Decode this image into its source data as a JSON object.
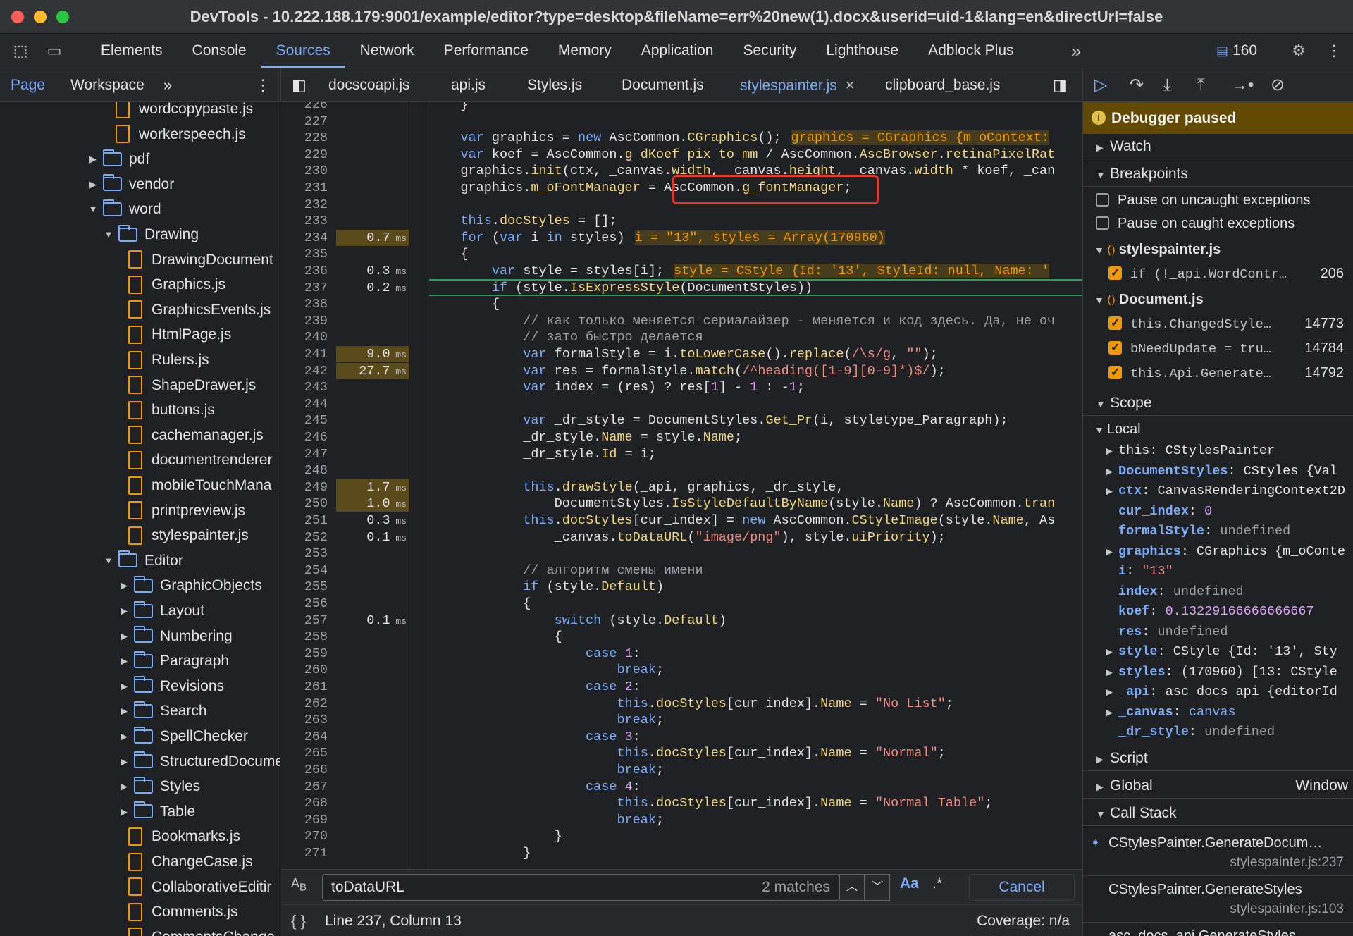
{
  "window": {
    "title": "DevTools - 10.222.188.179:9001/example/editor?type=desktop&fileName=err%20new(1).docx&userid=uid-1&lang=en&directUrl=false"
  },
  "panel_tabs": [
    "Elements",
    "Console",
    "Sources",
    "Network",
    "Performance",
    "Memory",
    "Application",
    "Security",
    "Lighthouse",
    "Adblock Plus"
  ],
  "active_panel": "Sources",
  "more_tabs": "»",
  "message_count": "160",
  "navigator": {
    "tabs": [
      "Page",
      "Workspace"
    ],
    "active": "Page",
    "more": "»"
  },
  "file_tabs": [
    "docscoapi.js",
    "api.js",
    "Styles.js",
    "Document.js",
    "stylespainter.js",
    "clipboard_base.js"
  ],
  "active_file": "stylespainter.js",
  "tree": [
    {
      "label": "wordcopypaste.js",
      "type": "file",
      "indent": 1
    },
    {
      "label": "workerspeech.js",
      "type": "file",
      "indent": 1
    },
    {
      "label": "pdf",
      "type": "folder",
      "indent": 0,
      "open": false
    },
    {
      "label": "vendor",
      "type": "folder",
      "indent": 0,
      "open": false
    },
    {
      "label": "word",
      "type": "folder",
      "indent": 0,
      "open": true
    },
    {
      "label": "Drawing",
      "type": "folder",
      "indent": 1,
      "open": true
    },
    {
      "label": "DrawingDocument",
      "type": "file",
      "indent": 2
    },
    {
      "label": "Graphics.js",
      "type": "file",
      "indent": 2
    },
    {
      "label": "GraphicsEvents.js",
      "type": "file",
      "indent": 2
    },
    {
      "label": "HtmlPage.js",
      "type": "file",
      "indent": 2
    },
    {
      "label": "Rulers.js",
      "type": "file",
      "indent": 2
    },
    {
      "label": "ShapeDrawer.js",
      "type": "file",
      "indent": 2
    },
    {
      "label": "buttons.js",
      "type": "file",
      "indent": 2
    },
    {
      "label": "cachemanager.js",
      "type": "file",
      "indent": 2
    },
    {
      "label": "documentrenderer",
      "type": "file",
      "indent": 2
    },
    {
      "label": "mobileTouchMana",
      "type": "file",
      "indent": 2
    },
    {
      "label": "printpreview.js",
      "type": "file",
      "indent": 2
    },
    {
      "label": "stylespainter.js",
      "type": "file",
      "indent": 2
    },
    {
      "label": "Editor",
      "type": "folder",
      "indent": 1,
      "open": true
    },
    {
      "label": "GraphicObjects",
      "type": "folder",
      "indent": 2,
      "open": false
    },
    {
      "label": "Layout",
      "type": "folder",
      "indent": 2,
      "open": false
    },
    {
      "label": "Numbering",
      "type": "folder",
      "indent": 2,
      "open": false
    },
    {
      "label": "Paragraph",
      "type": "folder",
      "indent": 2,
      "open": false
    },
    {
      "label": "Revisions",
      "type": "folder",
      "indent": 2,
      "open": false
    },
    {
      "label": "Search",
      "type": "folder",
      "indent": 2,
      "open": false
    },
    {
      "label": "SpellChecker",
      "type": "folder",
      "indent": 2,
      "open": false
    },
    {
      "label": "StructuredDocume",
      "type": "folder",
      "indent": 2,
      "open": false
    },
    {
      "label": "Styles",
      "type": "folder",
      "indent": 2,
      "open": false
    },
    {
      "label": "Table",
      "type": "folder",
      "indent": 2,
      "open": false
    },
    {
      "label": "Bookmarks.js",
      "type": "file",
      "indent": 2
    },
    {
      "label": "ChangeCase.js",
      "type": "file",
      "indent": 2
    },
    {
      "label": "CollaborativeEditir",
      "type": "file",
      "indent": 2
    },
    {
      "label": "Comments.js",
      "type": "file",
      "indent": 2
    },
    {
      "label": "CommentsChange",
      "type": "file",
      "indent": 2
    }
  ],
  "line_numbers": [
    "226",
    "227",
    "228",
    "229",
    "230",
    "231",
    "232",
    "233",
    "234",
    "235",
    "236",
    "237",
    "238",
    "239",
    "240",
    "241",
    "242",
    "243",
    "244",
    "245",
    "246",
    "247",
    "248",
    "249",
    "250",
    "251",
    "252",
    "253",
    "254",
    "255",
    "256",
    "257",
    "258",
    "259",
    "260",
    "261",
    "262",
    "263",
    "264",
    "265",
    "266",
    "267",
    "268",
    "269",
    "270",
    "271"
  ],
  "timings": [
    {
      "line": 234,
      "value": "0.7",
      "unit": "ms",
      "hot": true
    },
    {
      "line": 236,
      "value": "0.3",
      "unit": "ms",
      "hot": false
    },
    {
      "line": 237,
      "value": "0.2",
      "unit": "ms",
      "hot": false
    },
    {
      "line": 241,
      "value": "9.0",
      "unit": "ms",
      "hot": true
    },
    {
      "line": 242,
      "value": "27.7",
      "unit": "ms",
      "hot": true
    },
    {
      "line": 249,
      "value": "1.7",
      "unit": "ms",
      "hot": true
    },
    {
      "line": 250,
      "value": "1.0",
      "unit": "ms",
      "hot": true
    },
    {
      "line": 251,
      "value": "0.3",
      "unit": "ms",
      "hot": false
    },
    {
      "line": 252,
      "value": "0.1",
      "unit": "ms",
      "hot": false
    },
    {
      "line": 257,
      "value": "0.1",
      "unit": "ms",
      "hot": false
    }
  ],
  "code_lines": [
    "    }",
    "",
    "    var graphics = new AscCommon.CGraphics();",
    "    var koef = AscCommon.g_dKoef_pix_to_mm / AscCommon.AscBrowser.retinaPixelRat",
    "    graphics.init(ctx, _canvas.width, _canvas.height, _canvas.width * koef, _can",
    "    graphics.m_oFontManager = AscCommon.g_fontManager;",
    "",
    "    this.docStyles = [];",
    "    for (var i in styles)",
    "    {",
    "        var style = styles[i];",
    "        if (style.IsExpressStyle(DocumentStyles))",
    "        {",
    "            // как только меняется сериалайзер - меняется и код здесь. Да, не оч",
    "            // зато быстро делается",
    "            var formalStyle = i.toLowerCase().replace(/\\s/g, \"\");",
    "            var res = formalStyle.match(/^heading([1-9][0-9]*)$/);",
    "            var index = (res) ? res[1] - 1 : -1;",
    "",
    "            var _dr_style = DocumentStyles.Get_Pr(i, styletype_Paragraph);",
    "            _dr_style.Name = style.Name;",
    "            _dr_style.Id = i;",
    "",
    "            this.drawStyle(_api, graphics, _dr_style,",
    "                DocumentStyles.IsStyleDefaultByName(style.Name) ? AscCommon.tran",
    "            this.docStyles[cur_index] = new AscCommon.CStyleImage(style.Name, As",
    "                _canvas.toDataURL(\"image/png\"), style.uiPriority);",
    "",
    "            // алгоритм смены имени",
    "            if (style.Default)",
    "            {",
    "                switch (style.Default)",
    "                {",
    "                    case 1:",
    "                        break;",
    "                    case 2:",
    "                        this.docStyles[cur_index].Name = \"No List\";",
    "                        break;",
    "                    case 3:",
    "                        this.docStyles[cur_index].Name = \"Normal\";",
    "                        break;",
    "                    case 4:",
    "                        this.docStyles[cur_index].Name = \"Normal Table\";",
    "                        break;",
    "                }",
    "            }"
  ],
  "inline_values": {
    "228": "graphics = CGraphics {m_oContext:",
    "234": "i = \"13\", styles = Array(170960)",
    "236": "style = CStyle {Id: '13', StyleId: null, Name: '"
  },
  "paused_line": 237,
  "highlighted_value": "\"13\", styles = Array(170960)",
  "search": {
    "query": "toDataURL",
    "matches": "2 matches",
    "case_label": "Aa",
    "regex_label": ".*",
    "cancel": "Cancel"
  },
  "status": {
    "position": "Line 237, Column 13",
    "coverage": "Coverage: n/a"
  },
  "debugger": {
    "paused_label": "Debugger paused",
    "sections": {
      "watch": "Watch",
      "breakpoints": "Breakpoints",
      "scope": "Scope",
      "local": "Local",
      "script": "Script",
      "global": "Global",
      "global_value": "Window",
      "call_stack": "Call Stack"
    },
    "pause_uncaught": "Pause on uncaught exceptions",
    "pause_caught": "Pause on caught exceptions",
    "bp_groups": [
      {
        "file": "stylespainter.js",
        "items": [
          {
            "code": "if (!_api.WordContr…",
            "line": "206"
          }
        ]
      },
      {
        "file": "Document.js",
        "items": [
          {
            "code": "this.ChangedStyle…",
            "line": "14773"
          },
          {
            "code": "bNeedUpdate = tru…",
            "line": "14784"
          },
          {
            "code": "this.Api.Generate…",
            "line": "14792"
          }
        ]
      }
    ],
    "scope_vars": [
      {
        "name": "this",
        "value": "CStylesPainter",
        "expandable": true,
        "plain": true
      },
      {
        "name": "DocumentStyles",
        "value": "CStyles {Val",
        "expandable": true
      },
      {
        "name": "ctx",
        "value": "CanvasRenderingContext2D",
        "expandable": true
      },
      {
        "name": "cur_index",
        "value": "0",
        "expandable": false,
        "kind": "num"
      },
      {
        "name": "formalStyle",
        "value": "undefined",
        "expandable": false,
        "kind": "dim"
      },
      {
        "name": "graphics",
        "value": "CGraphics {m_oConte",
        "expandable": true
      },
      {
        "name": "i",
        "value": "\"13\"",
        "expandable": false,
        "kind": "str"
      },
      {
        "name": "index",
        "value": "undefined",
        "expandable": false,
        "kind": "dim"
      },
      {
        "name": "koef",
        "value": "0.13229166666666667",
        "expandable": false,
        "kind": "num"
      },
      {
        "name": "res",
        "value": "undefined",
        "expandable": false,
        "kind": "dim"
      },
      {
        "name": "style",
        "value": "CStyle {Id: '13', Sty",
        "expandable": true
      },
      {
        "name": "styles",
        "value": "(170960) [13: CStyle",
        "expandable": true
      },
      {
        "name": "_api",
        "value": "asc_docs_api {editorId",
        "expandable": true
      },
      {
        "name": "_canvas",
        "value": "canvas",
        "expandable": true,
        "kind": "tag"
      },
      {
        "name": "_dr_style",
        "value": "undefined",
        "expandable": false,
        "kind": "dim"
      }
    ],
    "call_stack": [
      {
        "fn": "CStylesPainter.GenerateDocum…",
        "loc": "stylespainter.js:237",
        "current": true
      },
      {
        "fn": "CStylesPainter.GenerateStyles",
        "loc": "stylespainter.js:103",
        "current": false
      },
      {
        "fn": "asc_docs_api.GenerateStyles",
        "loc": "",
        "current": false
      }
    ]
  },
  "colors": {
    "accent": "#7cacf8",
    "paused_bg": "#614a00",
    "breakpoint": "#f29900",
    "highlight_box": "#e63629"
  }
}
